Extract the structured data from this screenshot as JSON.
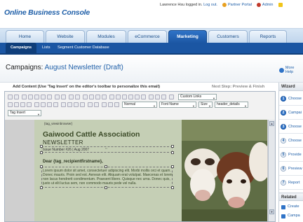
{
  "app": {
    "logo": "Online Business Console",
    "user_text": "Lawrence Hsu logged in.",
    "logout": "Log out.",
    "partner_portal": "Partner Portal",
    "admin": "Admin"
  },
  "main_tabs": [
    "Home",
    "Website",
    "Modules",
    "eCommerce",
    "Marketing",
    "Customers",
    "Reports"
  ],
  "active_main_tab": "Marketing",
  "sub_tabs": [
    "Campaigns",
    "Lists",
    "Segment Customer Database"
  ],
  "active_sub_tab": "Campaigns",
  "page": {
    "title_prefix": "Campaigns:",
    "title_highlight": "August Newsletter (Draft)",
    "more_help": "More Help"
  },
  "editor": {
    "add_content_label": "Add Content (Use 'Tag Insert' on the editor's toolbar to personalize this email)",
    "next_step": "Next Step: Preview & Finish",
    "custom_links": "Custom Links",
    "format": "Normal",
    "font": "Font Name",
    "size": "Size",
    "style": "header_details",
    "tag_insert": "Tag Insert"
  },
  "newsletter": {
    "tag_view": "{tag_viewinbrowser}",
    "org_name": "Gaiwood Cattle Association",
    "subtitle": "NEWSLETTER",
    "issue": "Issue Number #26 | Aug 2007",
    "greeting": "Dear {tag_recipientfirstname},",
    "body": "Lorem ipsum dolor sit amet, consectetuer adipiscing elit. Morbi mollis orci et quam. Donec mauris. Proin sed est. Aenean elit. Aliquam erat volutpat. Maecenas et lorem non lacus hendrerit condimentum. Praesent libero. Quisque nec urna. Donec quis, justo ut elit luctus sem, non commodo mauris pede vel nulla."
  },
  "wizard": {
    "title": "Wizard",
    "steps": [
      {
        "num": "1",
        "label": "Choose"
      },
      {
        "num": "2",
        "label": "Campai"
      },
      {
        "num": "3",
        "label": "Choose"
      },
      {
        "num": "4",
        "label": "Choose"
      },
      {
        "num": "5",
        "label": "Provide"
      },
      {
        "num": "6",
        "label": "Preview"
      },
      {
        "num": "7",
        "label": "Report"
      }
    ],
    "related_title": "Related",
    "related_items": [
      "Create",
      "Campa"
    ]
  },
  "colors": {
    "brand_blue": "#1f5fa8",
    "nav_dark": "#1b56a3",
    "newsletter_bg": "#c5cfb5"
  }
}
